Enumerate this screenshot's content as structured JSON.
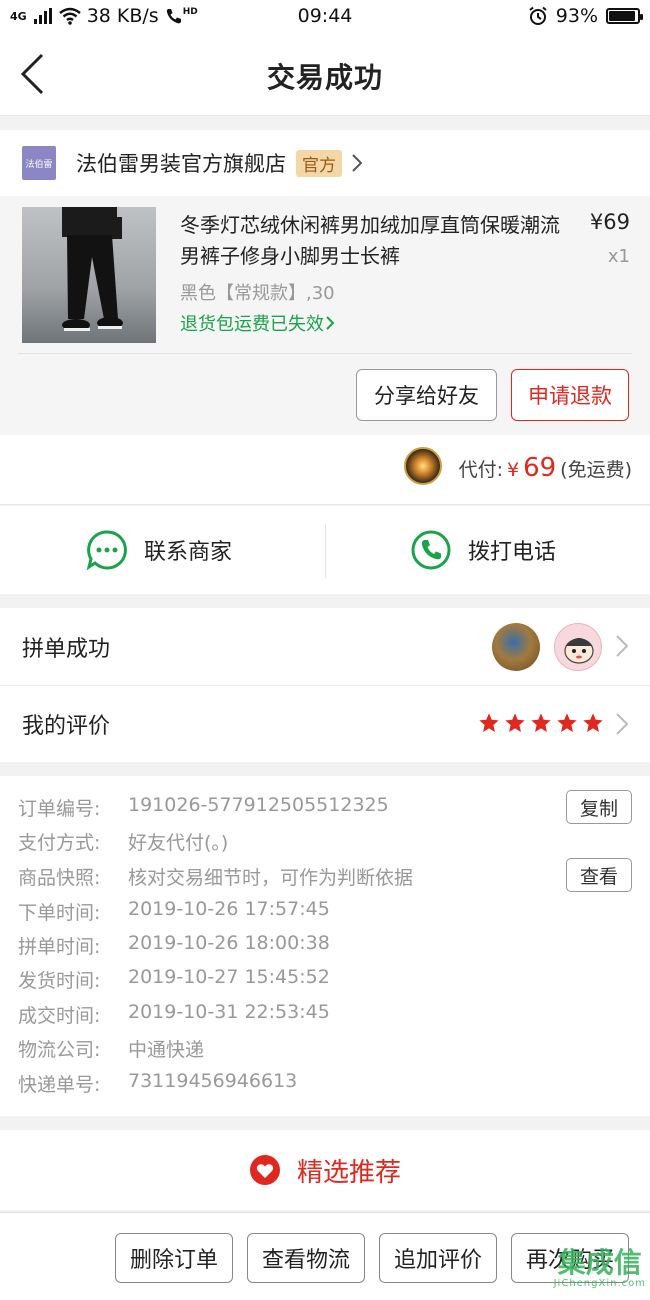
{
  "status_bar": {
    "network": "4G",
    "speed": "38 KB/s",
    "hd": "HD",
    "time": "09:44",
    "battery": "93%",
    "battery_level": 0.93
  },
  "header": {
    "title": "交易成功"
  },
  "shop": {
    "logo_text": "法伯雷",
    "name": "法伯雷男装官方旗舰店",
    "badge": "官方"
  },
  "product": {
    "title": "冬季灯芯绒休闲裤男加绒加厚直筒保暖潮流男裤子修身小脚男士长裤",
    "price": "¥69",
    "quantity": "x1",
    "spec": "黑色【常规款】,30",
    "return_note": "退货包运费已失效"
  },
  "actions": {
    "share": "分享给好友",
    "refund": "申请退款"
  },
  "payment": {
    "label": "代付:",
    "currency": "¥",
    "amount": "69",
    "note": "(免运费)"
  },
  "contact": {
    "message": "联系商家",
    "call": "拨打电话"
  },
  "group": {
    "label": "拼单成功"
  },
  "review": {
    "label": "我的评价",
    "stars": 5
  },
  "details": {
    "rows": [
      {
        "label": "订单编号:",
        "value": "191026-577912505512325"
      },
      {
        "label": "支付方式:",
        "value": "好友代付(。)"
      },
      {
        "label": "商品快照:",
        "value": "核对交易细节时，可作为判断依据"
      },
      {
        "label": "下单时间:",
        "value": "2019-10-26 17:57:45"
      },
      {
        "label": "拼单时间:",
        "value": "2019-10-26 18:00:38"
      },
      {
        "label": "发货时间:",
        "value": "2019-10-27 15:45:52"
      },
      {
        "label": "成交时间:",
        "value": "2019-10-31 22:53:45"
      },
      {
        "label": "物流公司:",
        "value": "中通快递"
      },
      {
        "label": "快递单号:",
        "value": "73119456946613"
      }
    ],
    "copy_button": "复制",
    "view_button": "查看"
  },
  "recommend": {
    "label": "精选推荐"
  },
  "bottom_bar": {
    "delete": "删除订单",
    "logistics": "查看物流",
    "add_review": "追加评价",
    "buy_again": "再次购买"
  },
  "watermark": {
    "top": "集成信",
    "bottom": "JiChengXin.com"
  },
  "colors": {
    "accent_red": "#e0281f",
    "green": "#1aa34a",
    "badge_bg": "#f4d7a7"
  }
}
